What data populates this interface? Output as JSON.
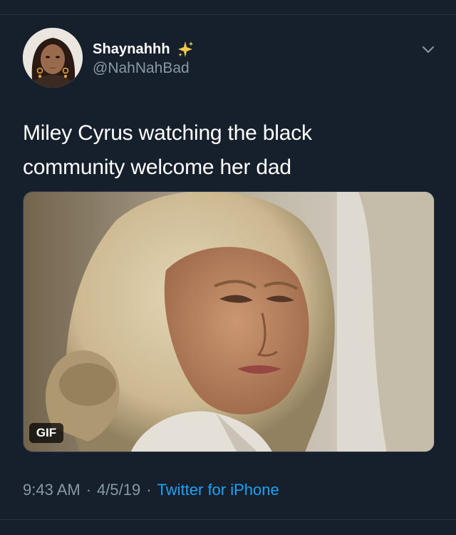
{
  "tweet": {
    "author": {
      "display_name": "Shaynahhh",
      "handle": "@NahNahBad"
    },
    "text_line1": "Miley Cyrus watching the black",
    "text_line2": "community welcome her dad",
    "media": {
      "badge": "GIF"
    },
    "meta": {
      "time": "9:43 AM",
      "separator": "·",
      "date": "4/5/19",
      "source": "Twitter for iPhone"
    },
    "icons": {
      "name_badge": "sparkles-icon",
      "menu": "chevron-down-icon"
    },
    "colors": {
      "background": "#16202c",
      "secondary_text": "#8899a6",
      "link": "#1da1f2",
      "sparkle": "#f2c94c"
    }
  }
}
